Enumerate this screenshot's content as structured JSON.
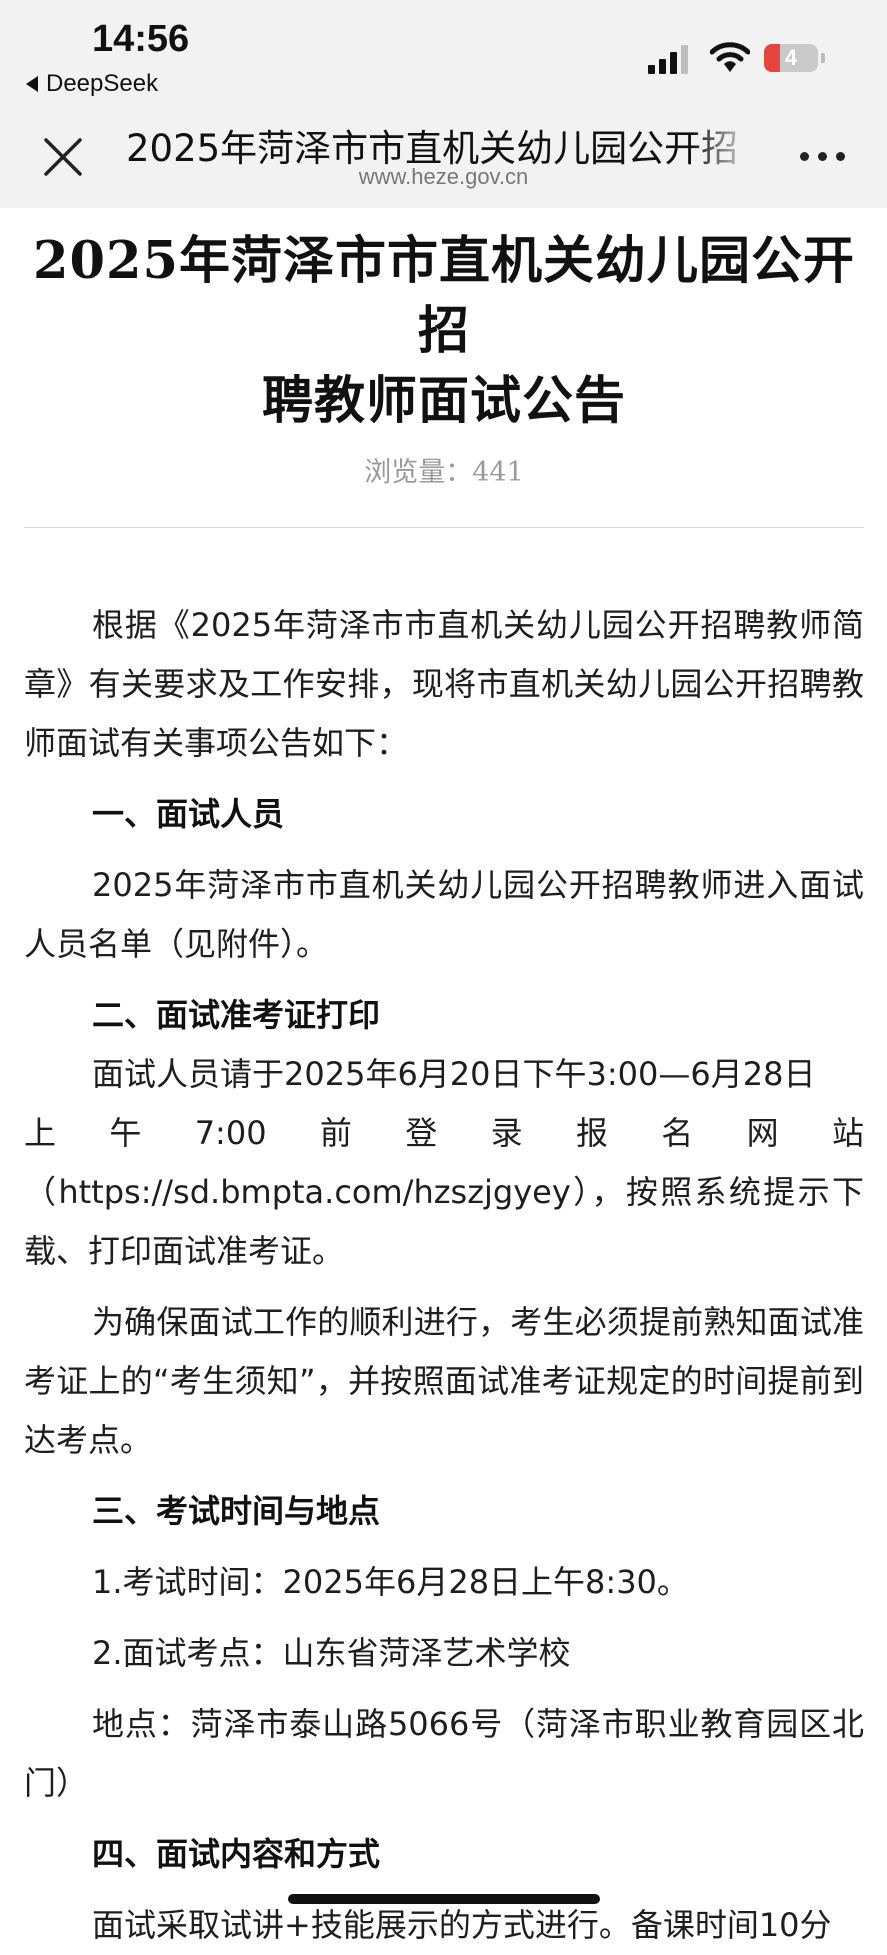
{
  "status_bar": {
    "time": "14:56",
    "back_app_label": "DeepSeek",
    "battery_level": "4",
    "battery_color": "#e5453b"
  },
  "browser": {
    "title": "2025年菏泽市市直机关幼儿园公开招",
    "domain": "www.heze.gov.cn"
  },
  "article": {
    "title_line1": "2025年菏泽市市直机关幼儿园公开招",
    "title_line2": "聘教师面试公告",
    "views": "浏览量：441",
    "intro": "根据《2025年菏泽市市直机关幼儿园公开招聘教师简章》有关要求及工作安排，现将市直机关幼儿园公开招聘教师面试有关事项公告如下：",
    "section1_heading": "一、面试人员",
    "section1_text": "2025年菏泽市市直机关幼儿园公开招聘教师进入面试人员名单（见附件）。",
    "section2_heading": "二、面试准考证打印",
    "section2_line1": "面试人员请于2025年6月20日下午3:00—6月28日",
    "section2_line2": "上午7:00前登录报名网站",
    "section2_line3": "（https://sd.bmpta.com/hzszjgyey），按照系统提示下载、打印面试准考证。",
    "section2_text2": "为确保面试工作的顺利进行，考生必须提前熟知面试准考证上的“考生须知”，并按照面试准考证规定的时间提前到达考点。",
    "section3_heading": "三、考试时间与地点",
    "section3_time": "1.考试时间：2025年6月28日上午8:30。",
    "section3_venue": "2.面试考点：山东省菏泽艺术学校",
    "section3_address": "地点：菏泽市泰山路5066号（菏泽市职业教育园区北门）",
    "section4_heading": "四、面试内容和方式",
    "section4_text": "面试采取试讲+技能展示的方式进行。备课时间10分"
  }
}
